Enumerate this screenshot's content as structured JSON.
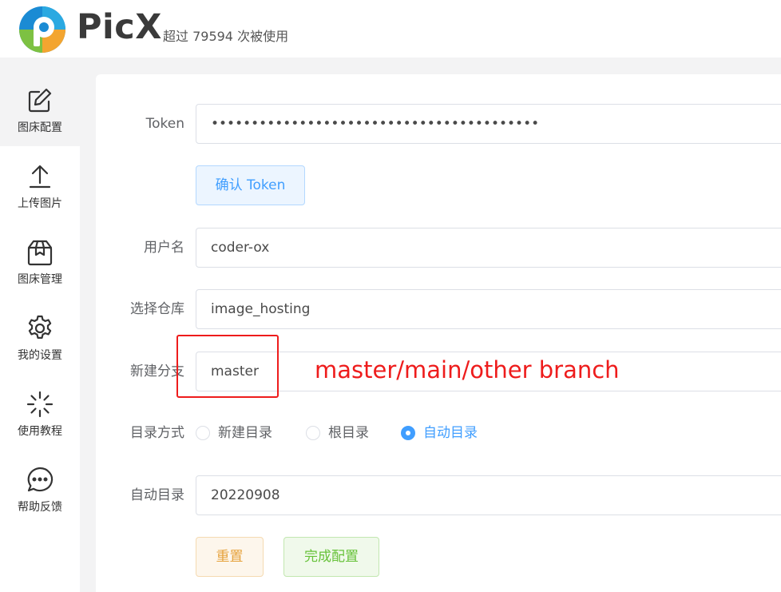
{
  "header": {
    "app_name": "PicX",
    "usage_text": "超过 79594 次被使用"
  },
  "sidebar": {
    "items": [
      {
        "label": "图床配置",
        "icon": "edit-icon",
        "active": true
      },
      {
        "label": "上传图片",
        "icon": "upload-icon",
        "active": false
      },
      {
        "label": "图床管理",
        "icon": "package-icon",
        "active": false
      },
      {
        "label": "我的设置",
        "icon": "gear-icon",
        "active": false
      },
      {
        "label": "使用教程",
        "icon": "loading-spark-icon",
        "active": false
      },
      {
        "label": "帮助反馈",
        "icon": "chat-bubble-icon",
        "active": false
      }
    ]
  },
  "form": {
    "token": {
      "label": "Token",
      "value": "•••••••••••••••••••••••••••••••••••••••••"
    },
    "confirm_button": "确认 Token",
    "username": {
      "label": "用户名",
      "value": "coder-ox"
    },
    "repo": {
      "label": "选择仓库",
      "value": "image_hosting"
    },
    "branch": {
      "label": "新建分支",
      "value": "master"
    },
    "dir_mode": {
      "label": "目录方式",
      "options": [
        "新建目录",
        "根目录",
        "自动目录"
      ],
      "selected": "自动目录"
    },
    "auto_dir": {
      "label": "自动目录",
      "value": "20220908"
    },
    "reset_button": "重置",
    "done_button": "完成配置"
  },
  "annotation": {
    "text": "master/main/other branch",
    "color": "#ee1c1c"
  },
  "colors": {
    "primary": "#409eff",
    "warning": "#e6a23c",
    "success": "#67c23a",
    "logo_blue": "#1b8bd4",
    "logo_green": "#7dc142"
  }
}
